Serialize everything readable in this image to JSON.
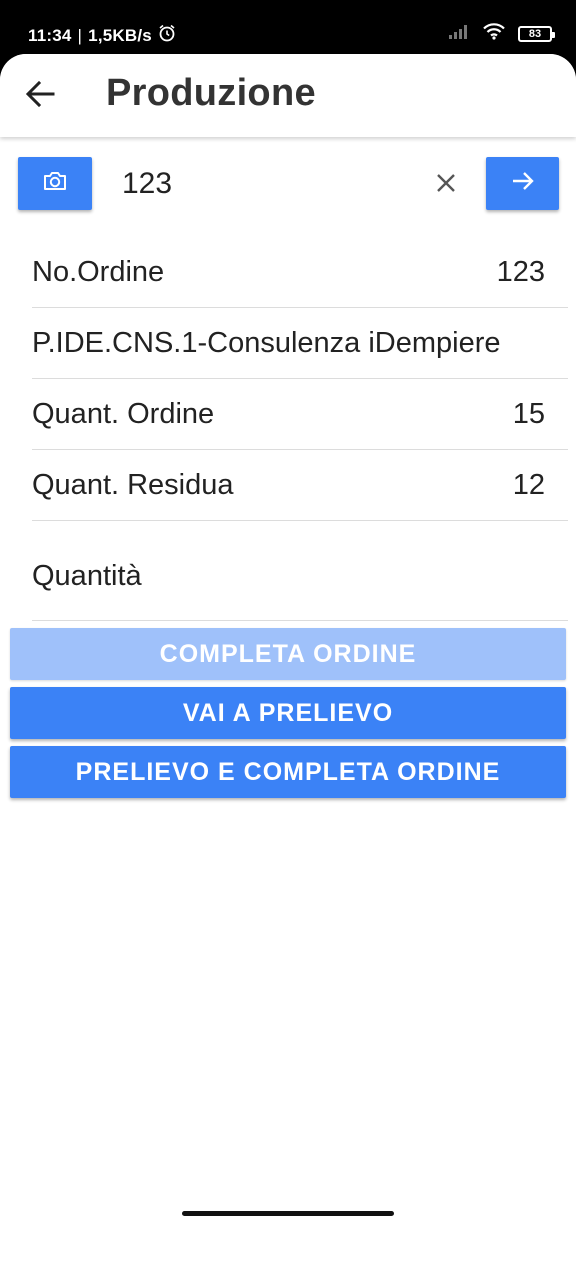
{
  "status_bar": {
    "time": "11:34",
    "separator": "|",
    "net_speed": "1,5KB/s",
    "battery": "83"
  },
  "app_bar": {
    "title": "Produzione",
    "back_icon": "arrow-left-icon"
  },
  "search": {
    "value": "123",
    "camera_icon": "camera-icon",
    "clear_icon": "close-icon",
    "go_icon": "arrow-right-icon"
  },
  "details": [
    {
      "label": "No.Ordine",
      "value": "123"
    },
    {
      "label": "P.IDE.CNS.1-Consulenza iDempiere",
      "value": ""
    },
    {
      "label": "Quant. Ordine",
      "value": "15"
    },
    {
      "label": "Quant. Residua",
      "value": "12"
    }
  ],
  "quantity": {
    "label": "Quantità",
    "value": ""
  },
  "buttons": {
    "complete": "COMPLETA ORDINE",
    "go_pick": "VAI A PRELIEVO",
    "pick_complete": "PRELIEVO E COMPLETA ORDINE"
  },
  "colors": {
    "accent": "#3b82f6",
    "accent_disabled": "#9fc1fa"
  }
}
